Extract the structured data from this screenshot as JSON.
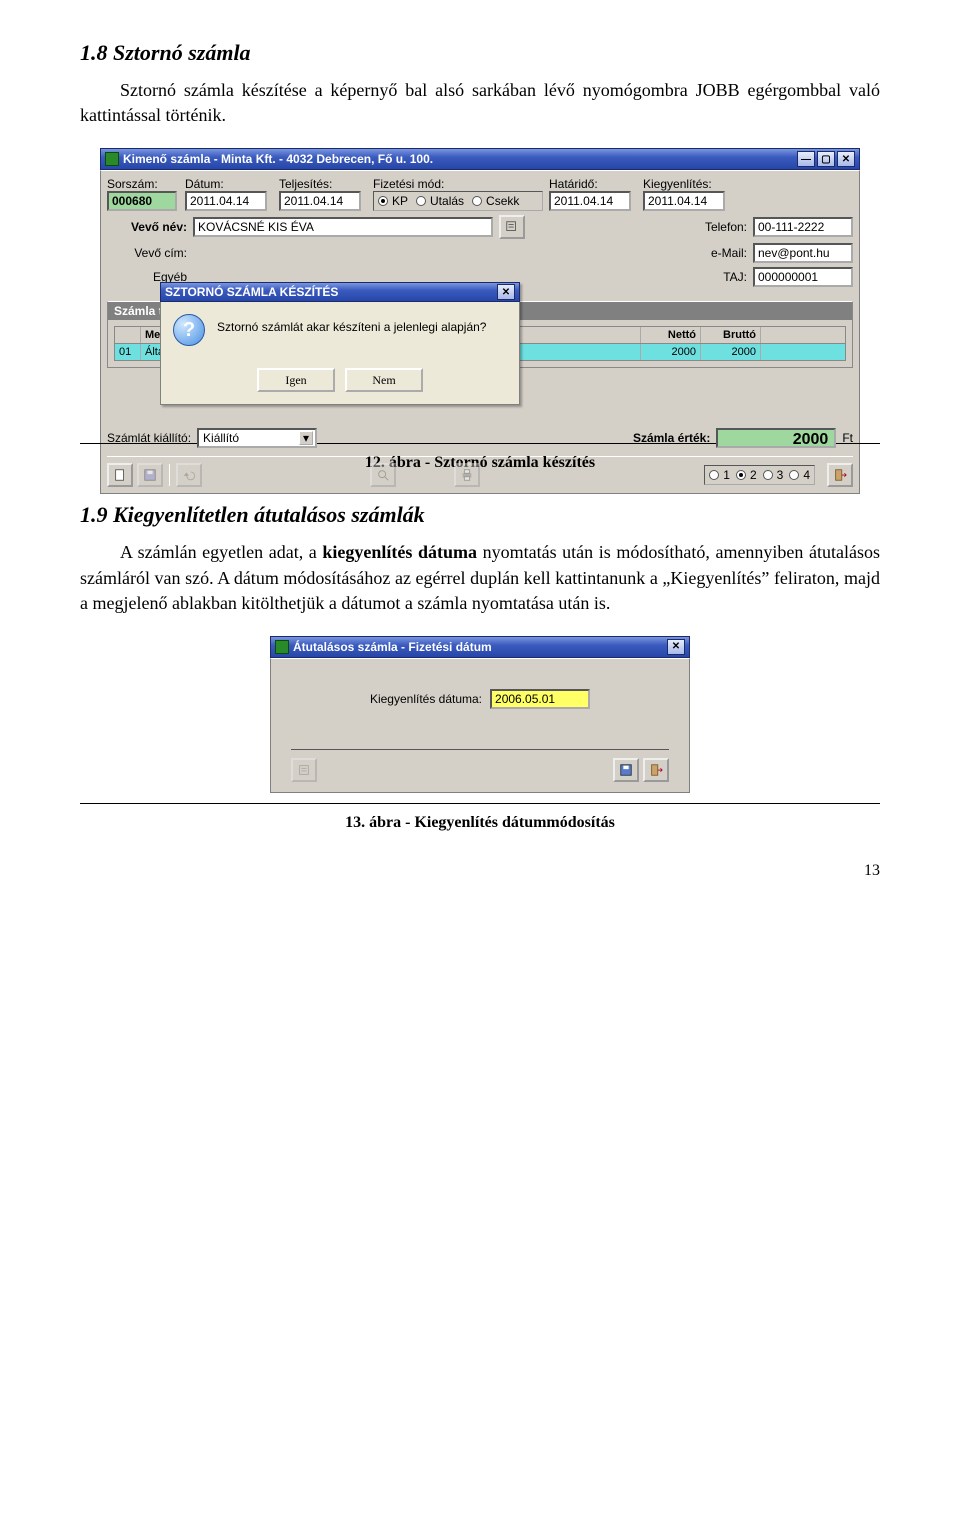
{
  "section1": {
    "heading": "1.8  Sztornó számla",
    "body": "Sztornó számla készítése a képernyő bal alsó sarkában lévő nyomógombra JOBB egérgombbal való kattintással történik."
  },
  "win1": {
    "title": "Kimenő számla - Minta Kft. - 4032 Debrecen, Fő u. 100.",
    "labels": {
      "sorszam": "Sorszám:",
      "datum": "Dátum:",
      "teljesites": "Teljesítés:",
      "fizmod": "Fizetési mód:",
      "hatarido": "Határidő:",
      "kiegy": "Kiegyenlítés:",
      "vevo_nev": "Vevő név:",
      "vevo_cim": "Vevő cím:",
      "egyeb": "Egyéb",
      "telefon": "Telefon:",
      "email": "e-Mail:",
      "taj": "TAJ:",
      "tetel_title": "Számla tételek",
      "megn": "Megn",
      "netto": "Nettó",
      "brutto": "Bruttó",
      "kiallito": "Számlát kiállító:",
      "ertek": "Számla érték:",
      "ft": "Ft"
    },
    "values": {
      "sorszam": "000680",
      "datum": "2011.04.14",
      "teljesites": "2011.04.14",
      "hatarido": "2011.04.14",
      "kiegy": "2011.04.14",
      "vevo_nev": "KOVÁCSNÉ KIS ÉVA",
      "telefon": "00-111-2222",
      "email": "nev@pont.hu",
      "taj": "000000001",
      "kiallito": "Kiállító",
      "ertek": "2000",
      "row_idx": "01",
      "row_megn": "Általános cucc betegellátás",
      "row_netto": "2000",
      "row_brutto": "2000"
    },
    "fizmod": {
      "kp": "KP",
      "utalas": "Utalás",
      "csekk": "Csekk"
    },
    "copies": [
      "1",
      "2",
      "3",
      "4"
    ]
  },
  "modal1": {
    "title": "SZTORNÓ SZÁMLA KÉSZÍTÉS",
    "msg": "Sztornó számlát akar készíteni a jelenlegi alapján?",
    "yes": "Igen",
    "no": "Nem"
  },
  "caption1": "12. ábra - Sztornó számla készítés",
  "section2": {
    "heading": "1.9  Kiegyenlítetlen átutalásos számlák",
    "body_before": "A számlán egyetlen adat, a ",
    "body_bold": "kiegyenlítés dátuma",
    "body_after": " nyomtatás után is módosítható, amennyiben átutalásos számláról van szó. A dátum módosításához az egérrel duplán kell kattintanunk a „Kiegyenlítés” feliraton, majd a megjelenő ablakban kitölthetjük a dátumot a számla nyomtatása után is."
  },
  "win2": {
    "title": "Átutalásos számla - Fizetési dátum",
    "label": "Kiegyenlítés dátuma:",
    "value": "2006.05.01"
  },
  "caption2": "13. ábra - Kiegyenlítés dátummódosítás",
  "page_no": "13"
}
